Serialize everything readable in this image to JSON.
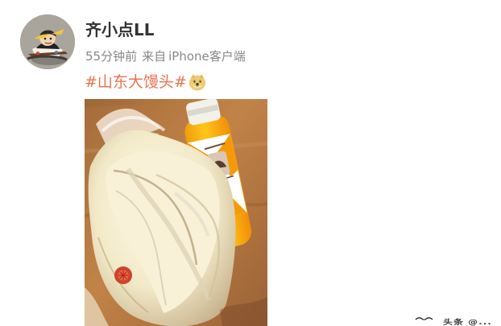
{
  "post": {
    "author": {
      "name": "齐小点LL",
      "avatar_icon": "cartoon-character-avatar"
    },
    "meta": {
      "time": "55分钟前",
      "source_prefix": "来自",
      "device": "iPhone客户端"
    },
    "topic": {
      "text": "#山东大馒头#",
      "emoji": "doge-emoji-icon",
      "color": "#eb7350"
    },
    "photo": {
      "description_label": "steamed bun and juice bottle photo"
    },
    "watermark": {
      "text": "头条 @..."
    }
  }
}
